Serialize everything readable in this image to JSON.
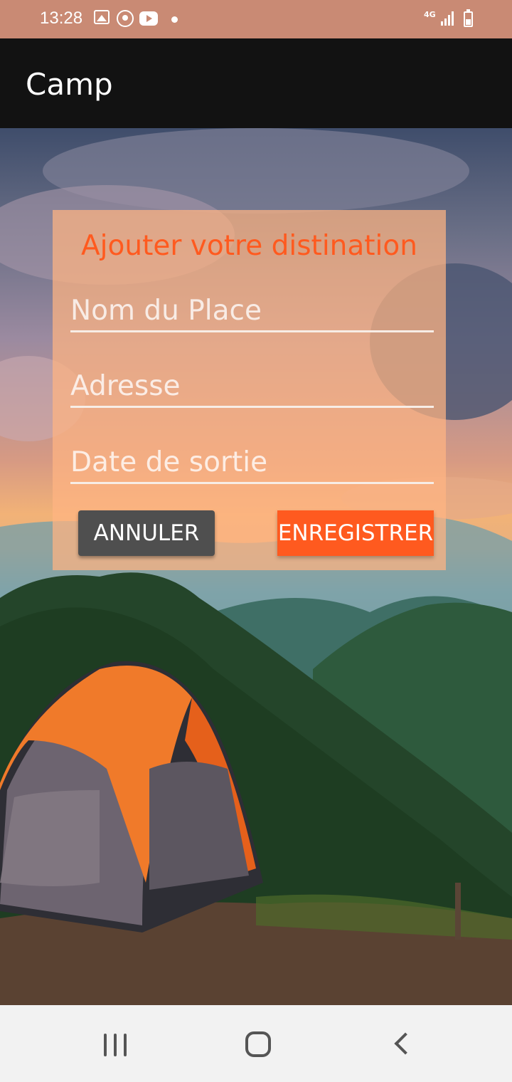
{
  "status_bar": {
    "time": "13:28",
    "network": "4G",
    "icons": [
      "gallery-icon",
      "whatsapp-icon",
      "youtube-icon",
      "notification-dot-icon",
      "signal-icon",
      "battery-icon"
    ]
  },
  "app_bar": {
    "title": "Camp"
  },
  "form": {
    "title": "Ajouter votre distination",
    "fields": [
      {
        "placeholder": "Nom du Place",
        "value": ""
      },
      {
        "placeholder": "Adresse",
        "value": ""
      },
      {
        "placeholder": "Date de sortie",
        "value": ""
      }
    ],
    "cancel_label": "ANNULER",
    "save_label": "ENREGISTRER"
  },
  "nav_bar": {
    "icons": [
      "recents-icon",
      "home-icon",
      "back-icon"
    ]
  },
  "colors": {
    "accent": "#ff5a1f",
    "card": "#ffb482",
    "cancel_button": "#4f4f4f",
    "app_bar": "#121212",
    "status_bar": "#c98a74"
  }
}
